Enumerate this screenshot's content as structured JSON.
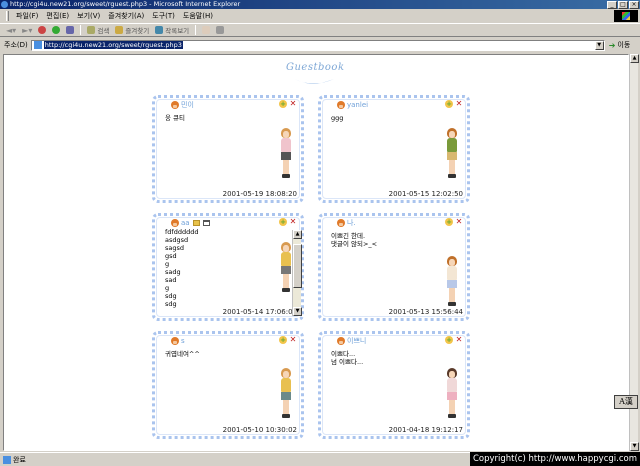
{
  "window": {
    "title": "http://cgi4u.new21.org/sweet/rguest.php3 - Microsoft Internet Explorer",
    "buttons": [
      "_",
      "□",
      "×"
    ]
  },
  "menu": [
    "파일(F)",
    "편집(E)",
    "보기(V)",
    "즐겨찾기(A)",
    "도구(T)",
    "도움말(H)"
  ],
  "toolbar": {
    "search_label": "검색",
    "favorites_label": "즐겨찾기",
    "history_label": "작록보기"
  },
  "address": {
    "label": "주소(D)",
    "url": "http://cgi4u.new21.org/sweet/rguest.php3",
    "go_label": "이동"
  },
  "logo_text": "Guestbook",
  "cards": [
    {
      "author": "민이",
      "body": "웅 큐티",
      "date": "2001-05-19 18:08:20",
      "figure": {
        "hair": "#d89a50",
        "top": "#f0c4cc",
        "skirt": "#555"
      }
    },
    {
      "author": "yanlei",
      "body": "ggg",
      "date": "2001-05-15 12:02:50",
      "figure": {
        "hair": "#c0702a",
        "top": "#7a9a3a",
        "skirt": "#d8b870"
      }
    },
    {
      "author": "aa",
      "body": "fdfdddddd\nasdgsd\nsagsd\ngsd\ng\nsadg\nsad\ng\nsdg\nsdg",
      "date": "2001-05-14 17:06:04",
      "has_contact": true,
      "figure": {
        "hair": "#d89a50",
        "top": "#e8c050",
        "skirt": "#777"
      }
    },
    {
      "author": "나.",
      "body": "이쁘긴 한데.\n댓글이 않되>_<",
      "date": "2001-05-13 15:56:44",
      "figure": {
        "hair": "#c0702a",
        "top": "#f3e6d4",
        "skirt": "#b8c8e8"
      }
    },
    {
      "author": "s",
      "body": "귀엽네여^^",
      "date": "2001-05-10 10:30:02",
      "figure": {
        "hair": "#d89a50",
        "top": "#e8c050",
        "skirt": "#6a8a8a"
      }
    },
    {
      "author": "이쁘니",
      "body": "이쁘다...\n넘 이쁘다...",
      "date": "2001-04-18 19:12:17",
      "figure": {
        "hair": "#5a3a2a",
        "top": "#f0d8d8",
        "skirt": "#eeb0c0"
      }
    }
  ],
  "status": {
    "text": "완료"
  },
  "copyright": "Copyright(c) http://www.happycgi.com",
  "ime": "A漢"
}
